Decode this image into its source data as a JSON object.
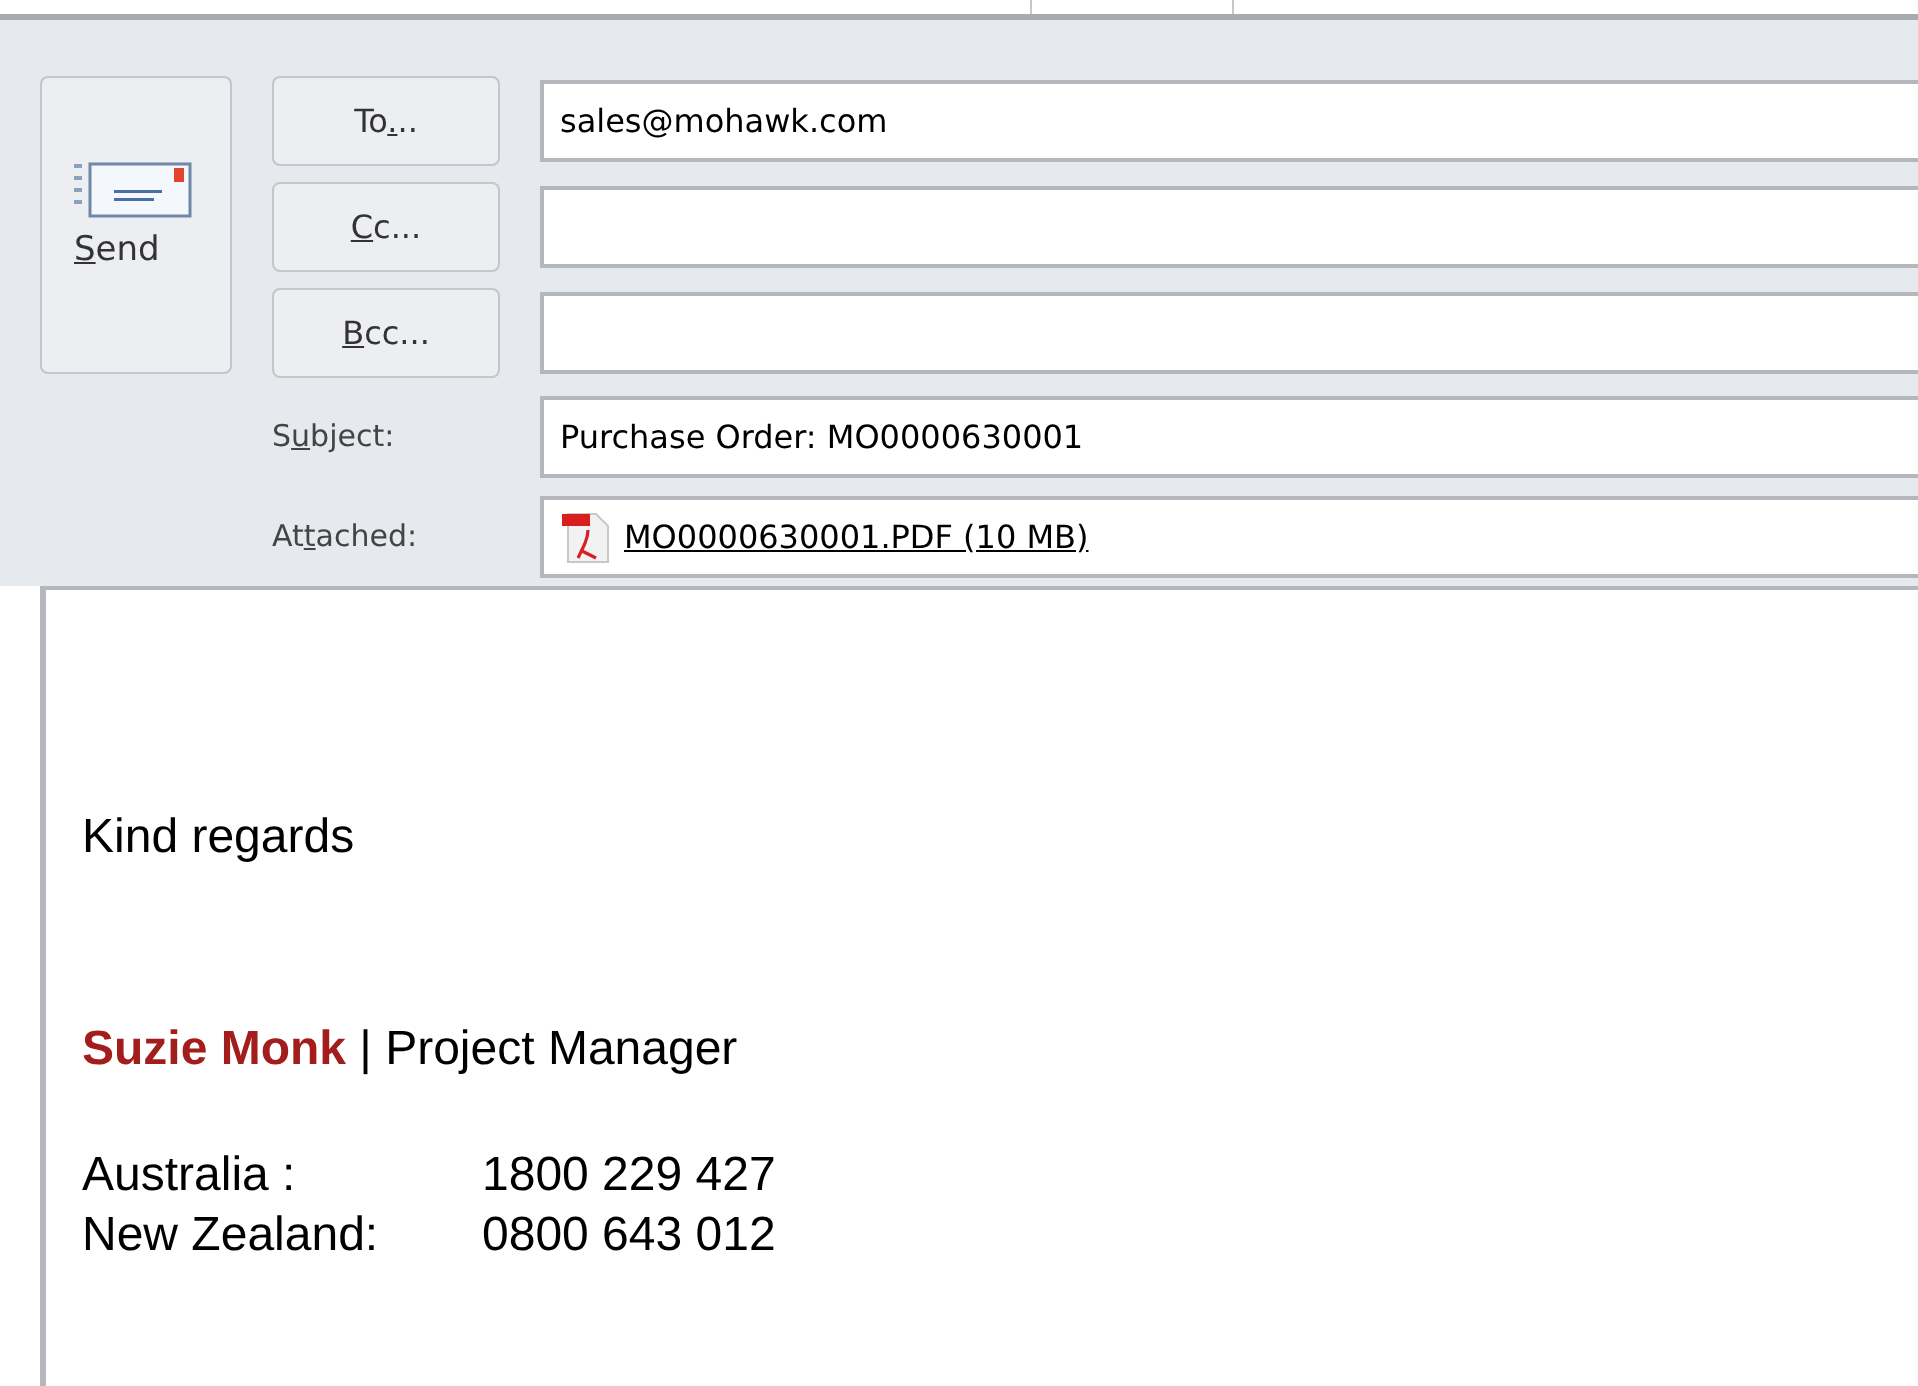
{
  "send_button": {
    "label": {
      "key": "S",
      "post": "end"
    }
  },
  "address_rows": [
    {
      "button": {
        "pre": "To",
        "key": ".",
        "post": ".."
      },
      "value": "sales@mohawk.com"
    },
    {
      "button": {
        "key": "C",
        "post": "c..."
      }
    },
    {
      "button": {
        "key": "B",
        "post": "cc..."
      }
    }
  ],
  "subject": {
    "label": {
      "pre": "S",
      "key": "u",
      "post": "bject:"
    },
    "value": "Purchase Order: MO0000630001"
  },
  "attached": {
    "label": {
      "pre": "At",
      "key": "t",
      "post": "ached:"
    },
    "file": "MO0000630001.PDF (10 MB)"
  },
  "body": {
    "greeting": "Kind regards",
    "signature": "**Suzie Monk** | Project Manager",
    "phones": [
      {
        "label": "Australia :",
        "number": "1800 229 427"
      },
      {
        "label": "New Zealand:",
        "number": "0800 643 012"
      }
    ]
  }
}
